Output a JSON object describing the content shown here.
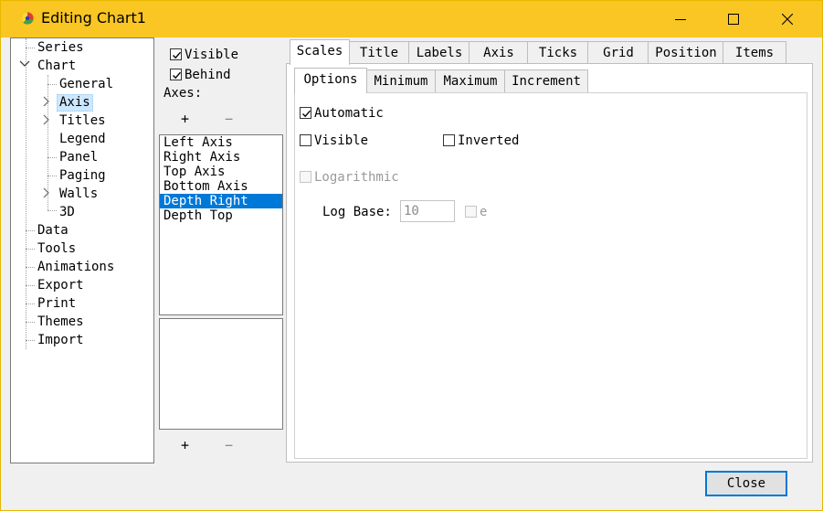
{
  "window": {
    "title": "Editing Chart1"
  },
  "tree": {
    "items": [
      {
        "label": "Series"
      },
      {
        "label": "Chart"
      },
      {
        "label": "General"
      },
      {
        "label": "Axis"
      },
      {
        "label": "Titles"
      },
      {
        "label": "Legend"
      },
      {
        "label": "Panel"
      },
      {
        "label": "Paging"
      },
      {
        "label": "Walls"
      },
      {
        "label": "3D"
      },
      {
        "label": "Data"
      },
      {
        "label": "Tools"
      },
      {
        "label": "Animations"
      },
      {
        "label": "Export"
      },
      {
        "label": "Print"
      },
      {
        "label": "Themes"
      },
      {
        "label": "Import"
      }
    ],
    "selected": "Axis"
  },
  "axes_panel": {
    "visible_label": "Visible",
    "behind_label": "Behind",
    "axes_label": "Axes:",
    "add_label": "+",
    "remove_label": "−",
    "axes": [
      "Left Axis",
      "Right Axis",
      "Top Axis",
      "Bottom Axis",
      "Depth Right",
      "Depth Top"
    ],
    "selected_axis": "Depth Right",
    "add2_label": "+",
    "remove2_label": "−"
  },
  "tabs": [
    "Scales",
    "Title",
    "Labels",
    "Axis",
    "Ticks",
    "Grid",
    "Position",
    "Items"
  ],
  "active_tab": "Scales",
  "subtabs": [
    "Options",
    "Minimum",
    "Maximum",
    "Increment"
  ],
  "active_subtab": "Options",
  "options": {
    "automatic_label": "Automatic",
    "visible_label": "Visible",
    "inverted_label": "Inverted",
    "logarithmic_label": "Logarithmic",
    "logbase_label": "Log Base:",
    "logbase_value": "10",
    "e_label": "e"
  },
  "footer": {
    "close_label": "Close"
  },
  "colors": {
    "titlebar": "#f9c623",
    "selection": "#0078d7",
    "tree_selection": "#cce8ff"
  }
}
